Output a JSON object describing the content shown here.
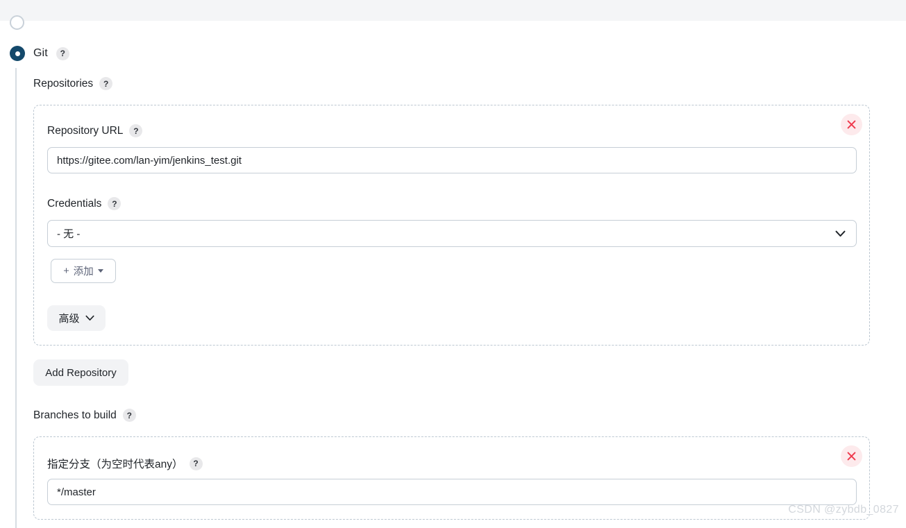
{
  "scm": {
    "git_label": "Git",
    "git_selected": true,
    "help_glyph": "?"
  },
  "repositories": {
    "section_label": "Repositories",
    "repo": {
      "url_label": "Repository URL",
      "url_value": "https://gitee.com/lan-yim/jenkins_test.git",
      "url_placeholder": "",
      "credentials_label": "Credentials",
      "credentials_value": "- 无 -",
      "add_credentials_label": "添加",
      "add_credentials_plus": "+",
      "advanced_label": "高级",
      "delete_title": "Delete repository"
    },
    "add_repository_label": "Add Repository"
  },
  "branches": {
    "section_label": "Branches to build",
    "branch": {
      "spec_label": "指定分支（为空时代表any）",
      "spec_value": "*/master",
      "spec_placeholder": "",
      "delete_title": "Delete branch"
    }
  },
  "watermark": {
    "text": "CSDN @zybdb_0827"
  },
  "colors": {
    "radio_selected": "#14496b",
    "dashed_border": "#bcc7d1",
    "input_border": "#c6ced6",
    "delete_bg": "#fdeaec",
    "delete_x": "#ef3b4e",
    "band_bg": "#f4f5f7",
    "pill_bg": "#f2f3f5"
  }
}
